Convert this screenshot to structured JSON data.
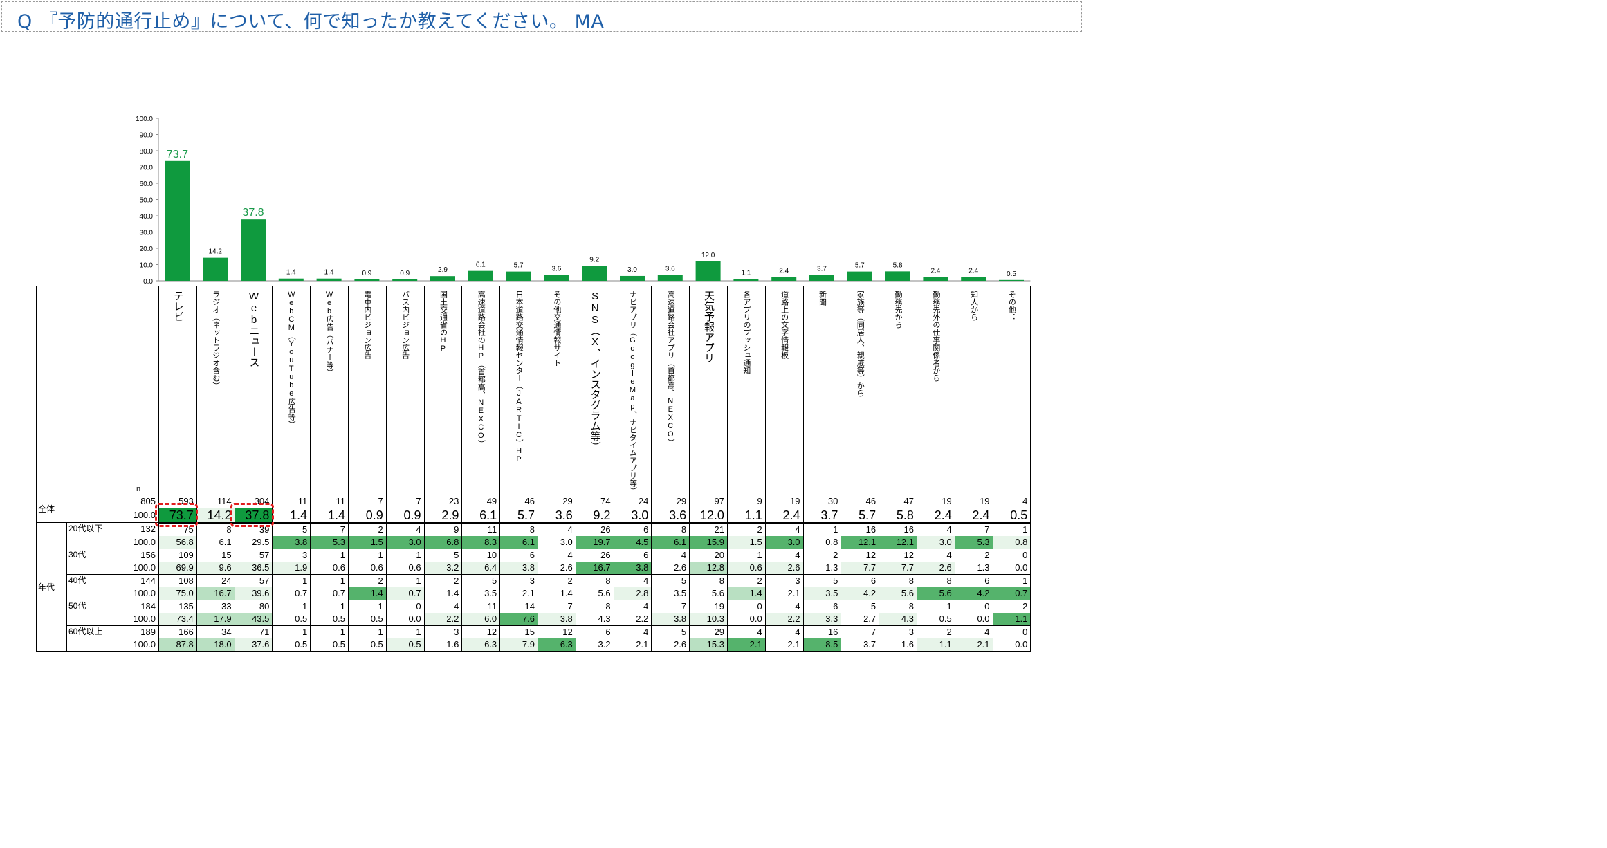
{
  "title": "Q 『予防的通行止め』について、何で知ったか教えてください。 MA",
  "n_label": "n",
  "colors": {
    "bar": "#0f9a3e",
    "highlight_text": "#1a9a4a",
    "title": "#1f5fa8",
    "callout": "#e11d1d"
  },
  "chart_data": {
    "type": "bar",
    "categories": [
      "テレビ",
      "ラジオ（ネットラジオ含む）",
      "Webニュース",
      "WebCM（YouTube広告等）",
      "Web広告（バナー等）",
      "電車内ビジョン広告",
      "バス内ビジョン広告",
      "国土交通省のHP",
      "高速道路会社のHP（首都高、NEXCO）",
      "日本道路交通情報センター（JARTIC）HP",
      "その他交通情報サイト",
      "SNS（X、インスタグラム等）",
      "ナビアプリ（GoogleMap、ナビタイムアプリ等）",
      "高速道路会社アプリ（首都高、NEXCO）",
      "天気予報アプリ",
      "各アプリのプッシュ通知",
      "道路上の文字情報板",
      "新聞",
      "家族等（同居人、親戚等）から",
      "勤務先から",
      "勤務先外の仕事関係者から",
      "知人から",
      "その他："
    ],
    "values": [
      73.7,
      14.2,
      37.8,
      1.4,
      1.4,
      0.9,
      0.9,
      2.9,
      6.1,
      5.7,
      3.6,
      9.2,
      3.0,
      3.6,
      12.0,
      1.1,
      2.4,
      3.7,
      5.7,
      5.8,
      2.4,
      2.4,
      0.5
    ],
    "value_labels": [
      "73.7",
      "14.2",
      "37.8",
      "1.4",
      "1.4",
      "0.9",
      "0.9",
      "2.9",
      "6.1",
      "5.7",
      "3.6",
      "9.2",
      "3.0",
      "3.6",
      "12.0",
      "1.1",
      "2.4",
      "3.7",
      "5.7",
      "5.8",
      "2.4",
      "2.4",
      "0.5"
    ],
    "highlighted": [
      0,
      2
    ],
    "yticks": [
      "0.0",
      "10.0",
      "20.0",
      "30.0",
      "40.0",
      "50.0",
      "60.0",
      "70.0",
      "80.0",
      "90.0",
      "100.0"
    ],
    "ylim": [
      0,
      100
    ],
    "grid": false,
    "legend": "none"
  },
  "header_labels": [
    "テレビ",
    "ラジオ（ネットラジオ含む）",
    "Webニュース",
    "WebCM（YouTube広告等）",
    "Web広告（バナー等）",
    "電車内ビジョン広告",
    "バス内ビジョン広告",
    "国土交通省のHP",
    "高速道路会社のHP（首都高、NEXCO）",
    "日本道路交通情報センター（JARTIC）HP",
    "その他交通情報サイト",
    "SNS（X、インスタグラム等）",
    "ナビアプリ（GoogleMap、ナビタイムアプリ等）",
    "高速道路会社アプリ（首都高、NEXCO）",
    "天気予報アプリ",
    "各アプリのプッシュ通知",
    "道路上の文字情報板",
    "新聞",
    "家族等（同居人、親戚等）から",
    "勤務先から",
    "勤務先外の仕事関係者から",
    "知人から",
    "その他："
  ],
  "table": {
    "total": {
      "label": "全体",
      "n": "805",
      "base": "100.0",
      "counts": [
        "593",
        "114",
        "304",
        "11",
        "11",
        "7",
        "7",
        "23",
        "49",
        "46",
        "29",
        "74",
        "24",
        "29",
        "97",
        "9",
        "19",
        "30",
        "46",
        "47",
        "19",
        "19",
        "4"
      ],
      "pcts": [
        "73.7",
        "14.2",
        "37.8",
        "1.4",
        "1.4",
        "0.9",
        "0.9",
        "2.9",
        "6.1",
        "5.7",
        "3.6",
        "9.2",
        "3.0",
        "3.6",
        "12.0",
        "1.1",
        "2.4",
        "3.7",
        "5.7",
        "5.8",
        "2.4",
        "2.4",
        "0.5"
      ]
    },
    "group_label": "年代",
    "rows": [
      {
        "label": "20代以下",
        "n": "132",
        "base": "100.0",
        "counts": [
          "75",
          "8",
          "39",
          "5",
          "7",
          "2",
          "4",
          "9",
          "11",
          "8",
          "4",
          "26",
          "6",
          "8",
          "21",
          "2",
          "4",
          "1",
          "16",
          "16",
          "4",
          "7",
          "1"
        ],
        "pcts": [
          "56.8",
          "6.1",
          "29.5",
          "3.8",
          "5.3",
          "1.5",
          "3.0",
          "6.8",
          "8.3",
          "6.1",
          "3.0",
          "19.7",
          "4.5",
          "6.1",
          "15.9",
          "1.5",
          "3.0",
          "0.8",
          "12.1",
          "12.1",
          "3.0",
          "5.3",
          "0.8"
        ],
        "shade": [
          1,
          0,
          0,
          3,
          3,
          3,
          3,
          3,
          3,
          3,
          0,
          3,
          3,
          3,
          3,
          1,
          3,
          0,
          3,
          3,
          1,
          3,
          1
        ]
      },
      {
        "label": "30代",
        "n": "156",
        "base": "100.0",
        "counts": [
          "109",
          "15",
          "57",
          "3",
          "1",
          "1",
          "1",
          "5",
          "10",
          "6",
          "4",
          "26",
          "6",
          "4",
          "20",
          "1",
          "4",
          "2",
          "12",
          "12",
          "4",
          "2",
          "0"
        ],
        "pcts": [
          "69.9",
          "9.6",
          "36.5",
          "1.9",
          "0.6",
          "0.6",
          "0.6",
          "3.2",
          "6.4",
          "3.8",
          "2.6",
          "16.7",
          "3.8",
          "2.6",
          "12.8",
          "0.6",
          "2.6",
          "1.3",
          "7.7",
          "7.7",
          "2.6",
          "1.3",
          "0.0"
        ],
        "shade": [
          1,
          1,
          1,
          1,
          0,
          0,
          0,
          1,
          1,
          1,
          0,
          3,
          3,
          0,
          2,
          1,
          1,
          0,
          1,
          1,
          1,
          0,
          0
        ]
      },
      {
        "label": "40代",
        "n": "144",
        "base": "100.0",
        "counts": [
          "108",
          "24",
          "57",
          "1",
          "1",
          "2",
          "1",
          "2",
          "5",
          "3",
          "2",
          "8",
          "4",
          "5",
          "8",
          "2",
          "3",
          "5",
          "6",
          "8",
          "8",
          "6",
          "1"
        ],
        "pcts": [
          "75.0",
          "16.7",
          "39.6",
          "0.7",
          "0.7",
          "1.4",
          "0.7",
          "1.4",
          "3.5",
          "2.1",
          "1.4",
          "5.6",
          "2.8",
          "3.5",
          "5.6",
          "1.4",
          "2.1",
          "3.5",
          "4.2",
          "5.6",
          "5.6",
          "4.2",
          "0.7"
        ],
        "shade": [
          1,
          2,
          1,
          0,
          0,
          3,
          1,
          0,
          0,
          0,
          0,
          0,
          1,
          0,
          0,
          2,
          0,
          1,
          1,
          1,
          3,
          3,
          3
        ]
      },
      {
        "label": "50代",
        "n": "184",
        "base": "100.0",
        "counts": [
          "135",
          "33",
          "80",
          "1",
          "1",
          "1",
          "0",
          "4",
          "11",
          "14",
          "7",
          "8",
          "4",
          "7",
          "19",
          "0",
          "4",
          "6",
          "5",
          "8",
          "1",
          "0",
          "2"
        ],
        "pcts": [
          "73.4",
          "17.9",
          "43.5",
          "0.5",
          "0.5",
          "0.5",
          "0.0",
          "2.2",
          "6.0",
          "7.6",
          "3.8",
          "4.3",
          "2.2",
          "3.8",
          "10.3",
          "0.0",
          "2.2",
          "3.3",
          "2.7",
          "4.3",
          "0.5",
          "0.0",
          "1.1"
        ],
        "shade": [
          1,
          2,
          2,
          0,
          0,
          0,
          0,
          1,
          1,
          3,
          1,
          0,
          0,
          1,
          1,
          0,
          1,
          1,
          0,
          1,
          0,
          0,
          3
        ]
      },
      {
        "label": "60代以上",
        "n": "189",
        "base": "100.0",
        "counts": [
          "166",
          "34",
          "71",
          "1",
          "1",
          "1",
          "1",
          "3",
          "12",
          "15",
          "12",
          "6",
          "4",
          "5",
          "29",
          "4",
          "4",
          "16",
          "7",
          "3",
          "2",
          "4",
          "0"
        ],
        "pcts": [
          "87.8",
          "18.0",
          "37.6",
          "0.5",
          "0.5",
          "0.5",
          "0.5",
          "1.6",
          "6.3",
          "7.9",
          "6.3",
          "3.2",
          "2.1",
          "2.6",
          "15.3",
          "2.1",
          "2.1",
          "8.5",
          "3.7",
          "1.6",
          "1.1",
          "2.1",
          "0.0"
        ],
        "shade": [
          2,
          2,
          1,
          0,
          0,
          0,
          1,
          0,
          1,
          1,
          3,
          0,
          0,
          0,
          2,
          3,
          0,
          3,
          0,
          0,
          1,
          1,
          0
        ]
      }
    ]
  }
}
